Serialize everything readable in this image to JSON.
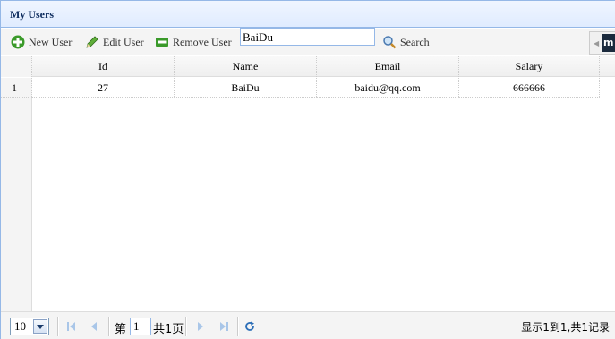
{
  "panel": {
    "title": "My Users"
  },
  "toolbar": {
    "new_label": "New User",
    "edit_label": "Edit User",
    "remove_label": "Remove User",
    "search_value": "BaiDu",
    "search_label": "Search"
  },
  "grid": {
    "columns": [
      "Id",
      "Name",
      "Email",
      "Salary"
    ],
    "rows": [
      {
        "rownum": "1",
        "id": "27",
        "name": "BaiDu",
        "email": "baidu@qq.com",
        "salary": "666666"
      }
    ]
  },
  "pager": {
    "page_size": "10",
    "page_prefix": "第",
    "page_number": "1",
    "page_total": "共1页",
    "info": "显示1到1,共1记录"
  },
  "side_logo": "m"
}
